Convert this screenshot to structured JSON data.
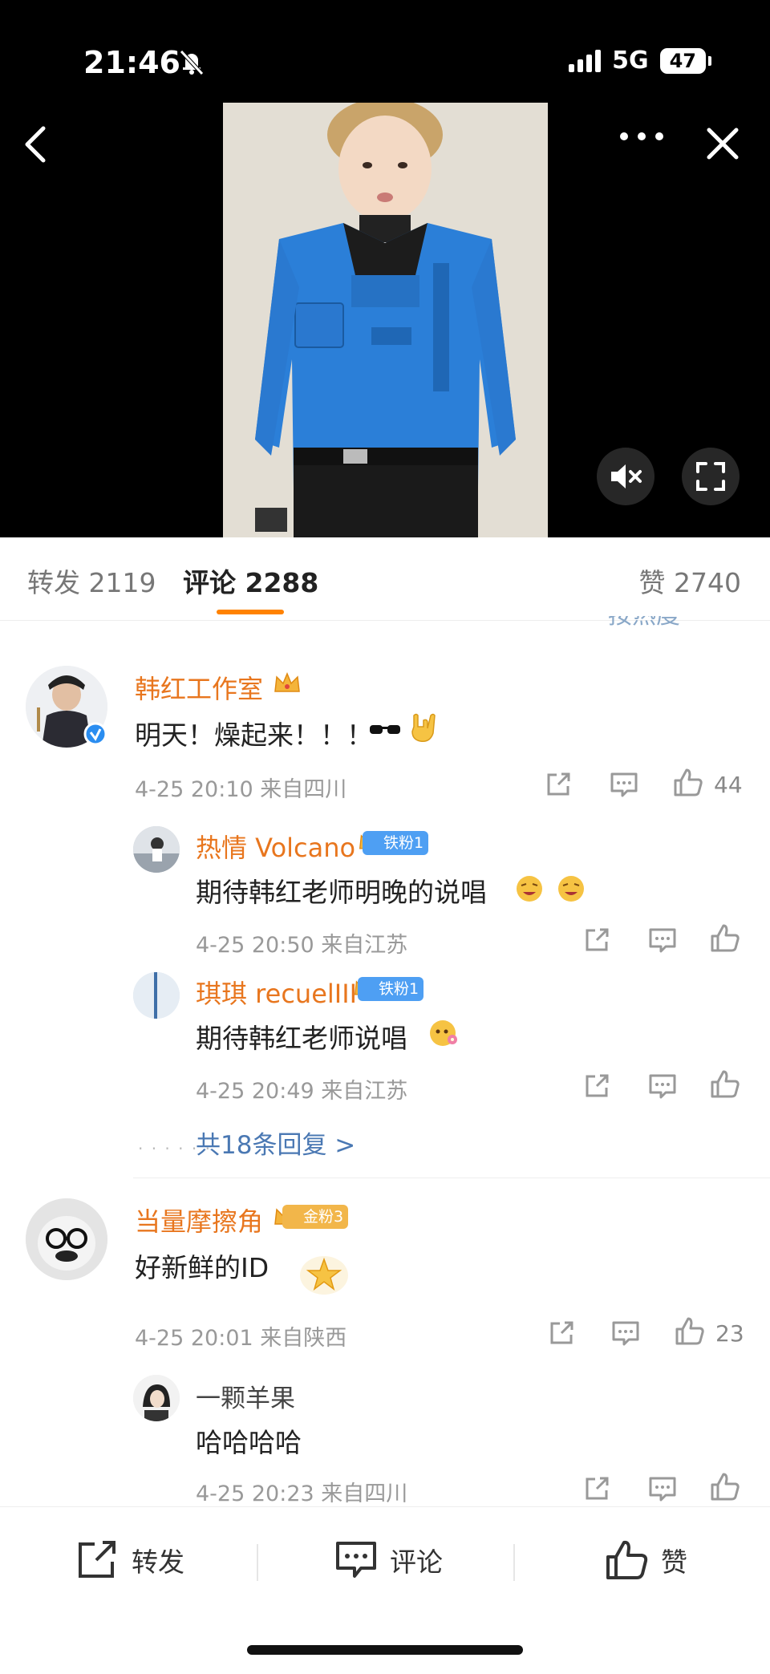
{
  "status": {
    "time": "21:46",
    "network": "5G",
    "battery": "47"
  },
  "tabs": {
    "repost_label": "转发",
    "repost_count": "2119",
    "comment_label": "评论",
    "comment_count": "2288",
    "like_label": "赞",
    "like_count": "2740"
  },
  "sort_label": "按热度",
  "comments": [
    {
      "author": "韩红工作室",
      "text": "明天！燥起来！！！",
      "meta": "4-25 20:10 来自四川",
      "likes": "44",
      "replies": [
        {
          "author": "热情 Volcano",
          "badge": "铁粉1",
          "text": "期待韩红老师明晚的说唱",
          "meta": "4-25 20:50 来自江苏"
        },
        {
          "author": "琪琪 recuelIII",
          "badge": "铁粉1",
          "text": "期待韩红老师说唱",
          "meta": "4-25 20:49 来自江苏"
        }
      ],
      "more_replies": "共18条回复 >"
    },
    {
      "author": "当量摩擦角",
      "badge": "金粉3",
      "text": "好新鲜的ID",
      "meta": "4-25 20:01 来自陕西",
      "likes": "23",
      "replies": [
        {
          "author": "一颗羊果",
          "text": "哈哈哈哈",
          "meta": "4-25 20:23 来自四川"
        }
      ]
    }
  ],
  "bottom_bar": {
    "repost": "转发",
    "comment": "评论",
    "like": "赞"
  },
  "colors": {
    "accent": "#ff8200",
    "name": "#e8761e",
    "link": "#4a78b3",
    "badge_iron": "#4e9ff3",
    "badge_gold": "#f2b64a"
  }
}
